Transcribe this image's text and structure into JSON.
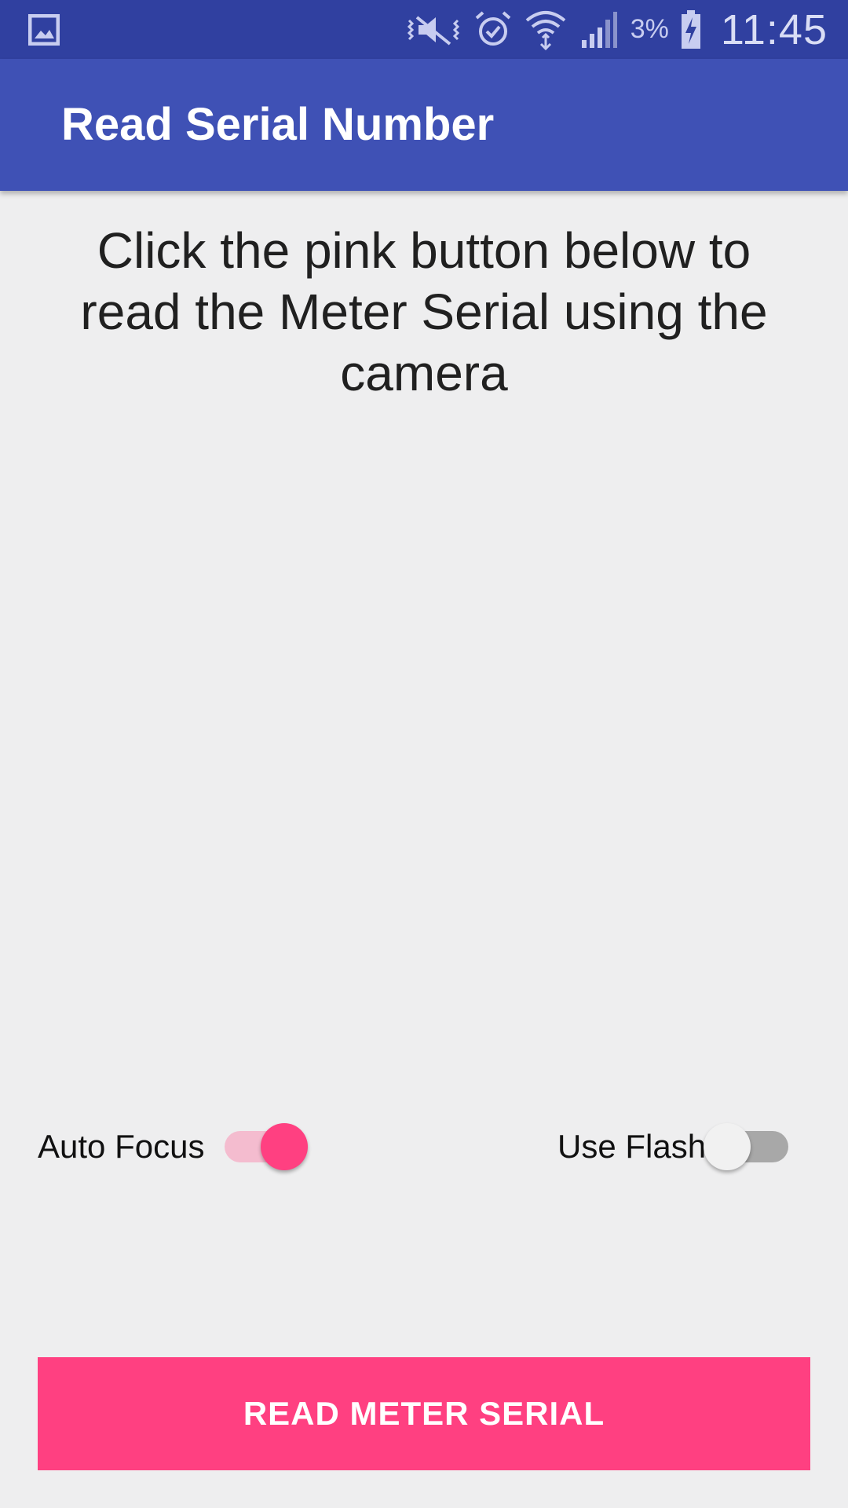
{
  "status_bar": {
    "icons": [
      "gallery-icon",
      "mute-vibrate-icon",
      "alarm-icon",
      "wifi-icon",
      "cell-signal-icon",
      "battery-charging-icon"
    ],
    "battery_percent": "3%",
    "time": "11:45"
  },
  "app_bar": {
    "title": "Read Serial Number"
  },
  "main": {
    "instructions": "Click the pink button below to read the Meter Serial using the camera"
  },
  "switches": {
    "auto_focus": {
      "label": "Auto Focus",
      "checked": true
    },
    "use_flash": {
      "label": "Use Flash",
      "checked": false
    }
  },
  "read_button": {
    "label": "READ METER SERIAL"
  },
  "colors": {
    "status_bar": "#3040a0",
    "primary": "#3f51b5",
    "accent": "#ff4081",
    "background": "#eeeeef"
  }
}
